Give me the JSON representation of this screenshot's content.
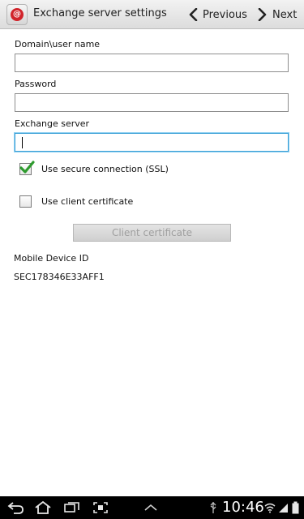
{
  "header": {
    "title": "Exchange server settings",
    "previous_label": "Previous",
    "next_label": "Next",
    "app_icon_glyph": "@"
  },
  "form": {
    "domain_label": "Domain\\user name",
    "domain_value": "",
    "password_label": "Password",
    "password_value": "",
    "server_label": "Exchange server",
    "server_value": "",
    "ssl_label": "Use secure connection (SSL)",
    "ssl_checked": true,
    "cert_label": "Use client certificate",
    "cert_checked": false,
    "client_cert_button": "Client certificate",
    "device_id_label": "Mobile Device ID",
    "device_id_value": "SEC178346E33AFF1"
  },
  "status_bar": {
    "time": "10:46"
  },
  "colors": {
    "accent": "#3ba0d6",
    "check": "#2e9b2e",
    "app_icon": "#d1242b"
  }
}
